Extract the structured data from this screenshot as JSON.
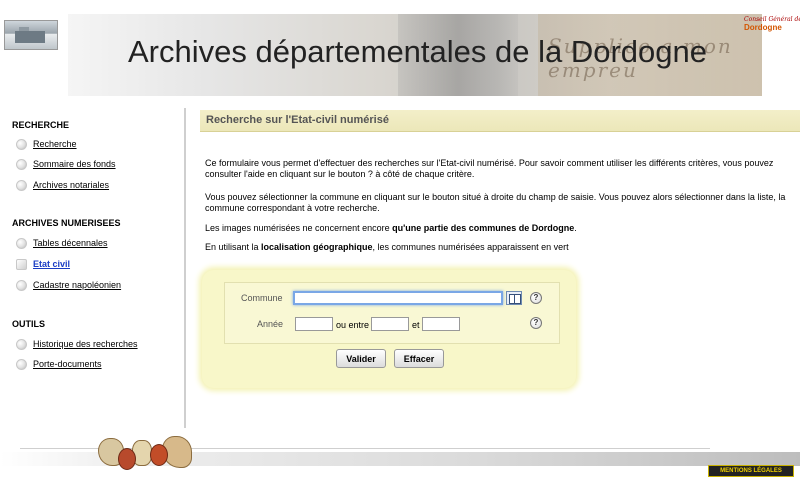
{
  "header": {
    "title": "Archives départementales de la Dordogne",
    "banner_script": "Supplico a mon empreu",
    "cg_logo_line1": "Conseil Général de la",
    "cg_logo_line2": "Dordogne"
  },
  "sidebar": {
    "sections": [
      {
        "title": "RECHERCHE",
        "items": [
          "Recherche",
          "Sommaire des fonds",
          "Archives notariales"
        ]
      },
      {
        "title": "ARCHIVES NUMERISEES",
        "items": [
          "Tables décennales",
          "Etat civil",
          "Cadastre napoléonien"
        ]
      },
      {
        "title": "OUTILS",
        "items": [
          "Historique des recherches",
          "Porte-documents"
        ]
      }
    ],
    "active_item": "Etat civil"
  },
  "main": {
    "page_title": "Recherche sur l'Etat-civil numérisé",
    "p1": "Ce formulaire vous permet d'effectuer des recherches sur l'Etat-civil numérisé. Pour savoir comment utiliser les différents critères, vous pouvez consulter l'aide en cliquant sur le bouton ? à côté de chaque critère.",
    "p2": "Vous pouvez sélectionner la commune en cliquant sur le bouton situé à droite du champ de saisie. Vous pouvez alors sélectionner dans la liste, la commune correspondant à votre recherche.",
    "p3_a": "Les images numérisées ne concernent encore ",
    "p3_b": "qu'une partie des communes de Dordogne",
    "p3_c": ".",
    "p4_a": "En utilisant la ",
    "p4_b": "localisation géographique",
    "p4_c": ", les communes numérisées apparaissent en vert"
  },
  "form": {
    "commune_label": "Commune",
    "commune_value": "",
    "annee_label": "Année",
    "annee_value": "",
    "ou_entre": "ou entre",
    "entre_from": "",
    "et": "et",
    "entre_to": "",
    "help_glyph": "?",
    "valider": "Valider",
    "effacer": "Effacer"
  },
  "footer": {
    "legal": "MENTIONS LÉGALES"
  }
}
